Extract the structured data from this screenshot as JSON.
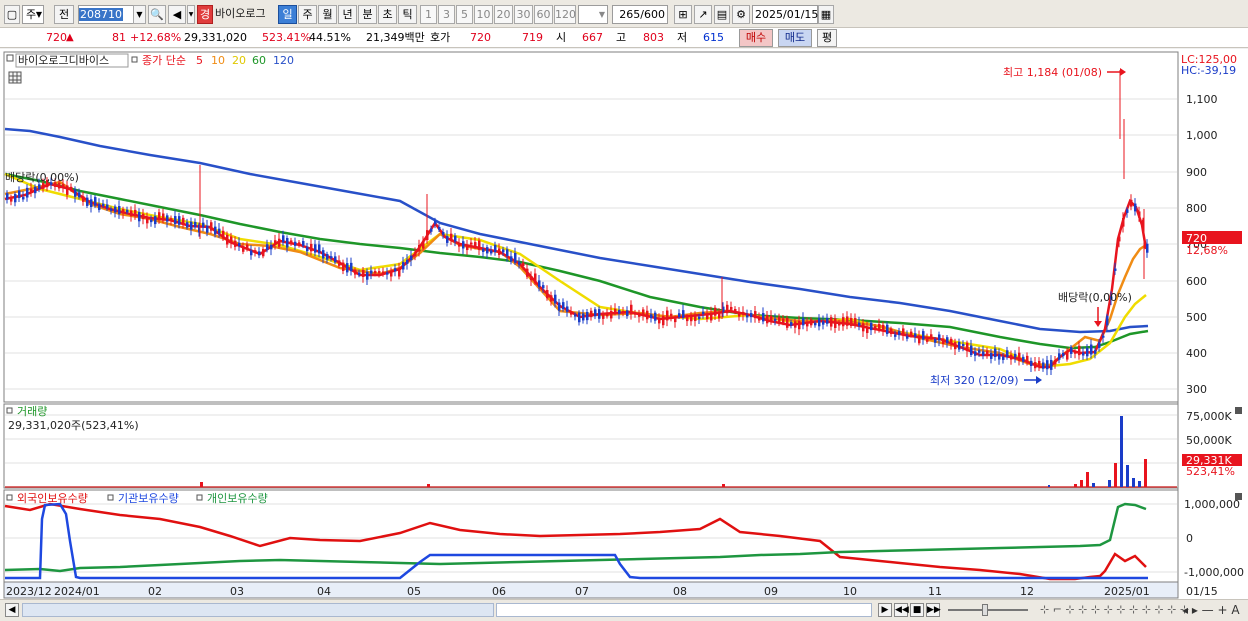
{
  "toolbar": {
    "period_select": "주",
    "prev_label": "전",
    "code_value": "208710",
    "badge": "경",
    "stock_name": "바이오로그",
    "timeframes": [
      "일",
      "주",
      "월",
      "년",
      "분",
      "초",
      "틱"
    ],
    "active_timeframe": "일",
    "intervals": [
      "1",
      "3",
      "5",
      "10",
      "20",
      "30",
      "60",
      "120"
    ],
    "count": "265",
    "total": "/600",
    "date": "2025/01/15"
  },
  "quote": {
    "price": "720",
    "change_arrow": "▲",
    "change": "81",
    "change_pct": "+12.68%",
    "volume": "29,331,020",
    "volume_ratio": "523.41%",
    "turnover": "44.51%",
    "amount": "21,349백만",
    "hoga_label": "호가",
    "ask": "720",
    "bid": "719",
    "open_label": "시",
    "open": "667",
    "high_label": "고",
    "high": "803",
    "low_label": "저",
    "low": "615",
    "buy_label": "매수",
    "sell_label": "매도",
    "avg_label": "평"
  },
  "price_panel": {
    "stock_name": "바이오로그디바이스",
    "ma_title": "종가 단순",
    "ma_periods": [
      {
        "label": "5",
        "color": "#e8141e"
      },
      {
        "label": "10",
        "color": "#f08c14"
      },
      {
        "label": "20",
        "color": "#f0dc00"
      },
      {
        "label": "60",
        "color": "#1e9628"
      },
      {
        "label": "120",
        "color": "#2850c8"
      }
    ],
    "lc": "LC:125,00",
    "hc": "HC:-39,19",
    "ticks": [
      "1,100",
      "1,000",
      "900",
      "800",
      "700",
      "600",
      "500",
      "400",
      "300"
    ],
    "current_price": "720",
    "current_pct": "12,68%",
    "high_annot": "최고 1,184 (01/08)",
    "low_annot": "최저 320 (12/09)",
    "div1": "배당락(0,00%)",
    "div2": "배당락(0,00%)"
  },
  "volume_panel": {
    "title": "거래량",
    "value": "29,331,020주(523,41%)",
    "ticks": [
      "75,000K",
      "50,000K",
      "25,000K"
    ],
    "current": "29,331K",
    "current_pct": "523,41%"
  },
  "holdings_panel": {
    "foreign": "외국인보유수량",
    "institution": "기관보유수량",
    "individual": "개인보유수량",
    "ticks": [
      "1,000,000",
      "0",
      "-1,000,000"
    ]
  },
  "xaxis": [
    "2023/12",
    "2024/01",
    "02",
    "03",
    "04",
    "05",
    "06",
    "07",
    "08",
    "09",
    "10",
    "11",
    "12",
    "2025/01",
    "01/15"
  ],
  "colors": {
    "up": "#e8141e",
    "down": "#1a3cc8",
    "ma5": "#e8141e",
    "ma10": "#f08c14",
    "ma20": "#f0dc00",
    "ma60": "#1e9628",
    "ma120": "#2850c8",
    "foreign": "#e01010",
    "institution": "#1e48e0",
    "individual": "#1e9640"
  }
}
